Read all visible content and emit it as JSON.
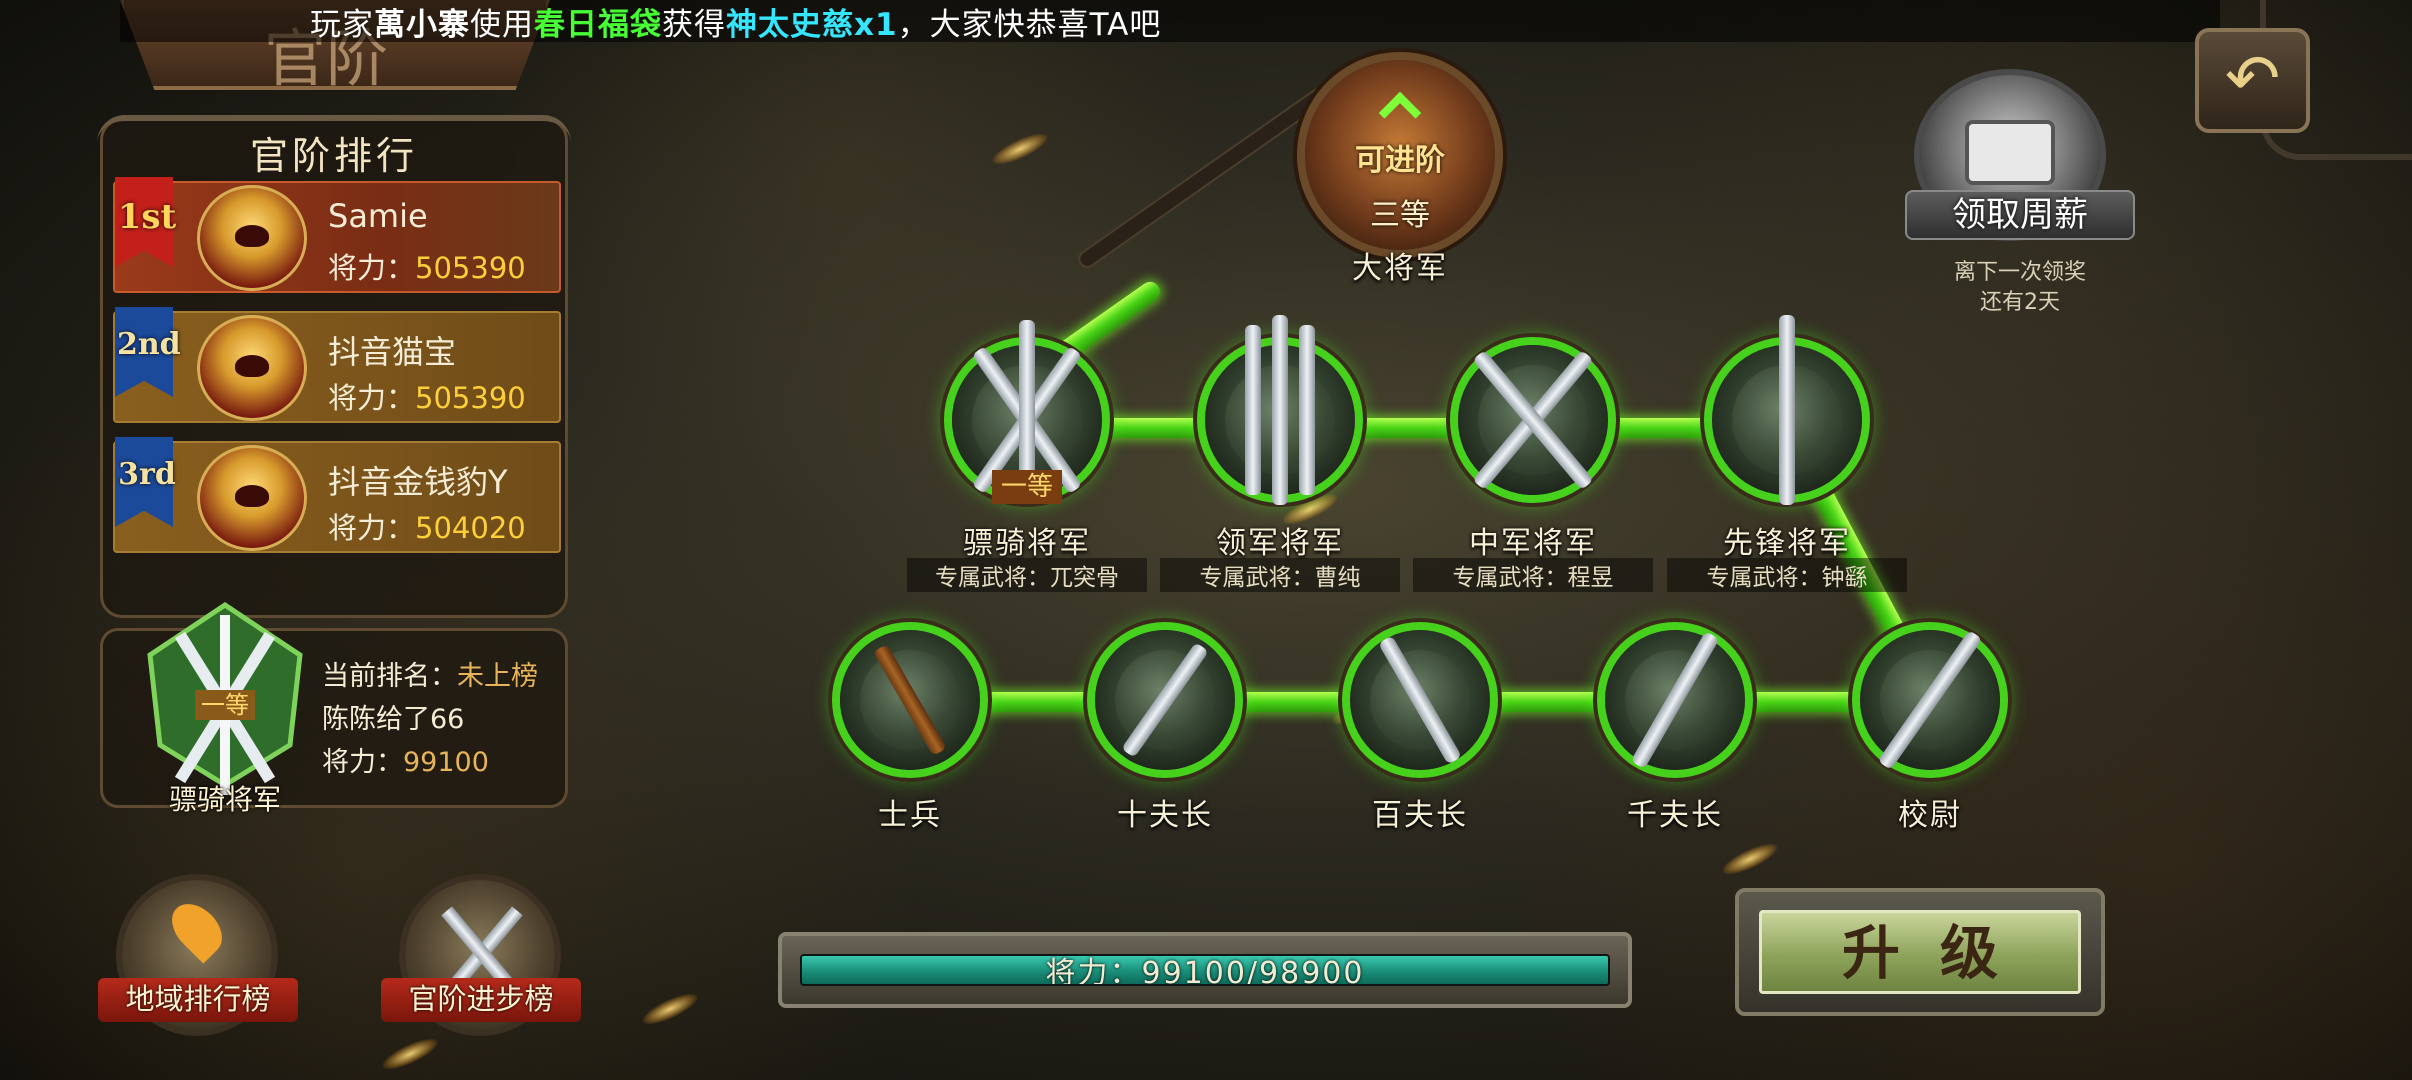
{
  "ticker": {
    "prefix": "玩家",
    "player": "萬小寨",
    "used": "使用",
    "item": "春日福袋",
    "got": "获得",
    "reward": "神太史慈x1",
    "suffix": "，大家快恭喜TA吧"
  },
  "title": "官阶",
  "ranking": {
    "title": "官阶排行",
    "power_label": "将力：",
    "rows": [
      {
        "medal": "1st",
        "name": "Samie",
        "power": "505390"
      },
      {
        "medal": "2nd",
        "name": "抖音猫宝",
        "power": "505390"
      },
      {
        "medal": "3rd",
        "name": "抖音金钱豹Y",
        "power": "504020"
      }
    ]
  },
  "my_rank": {
    "emblem_grade": "一等",
    "emblem_name": "骠骑将军",
    "current_rank_label": "当前排名：",
    "current_rank_value": "未上榜",
    "player_name": "陈陈给了66",
    "power_label": "将力：",
    "power_value": "99100"
  },
  "ranks": {
    "top": {
      "status": "可进阶",
      "grade": "三等",
      "name": "大将军"
    },
    "generals": [
      {
        "name": "骠骑将军",
        "grade": "一等",
        "bound": "专属武将：兀突骨"
      },
      {
        "name": "领军将军",
        "bound": "专属武将：曹纯"
      },
      {
        "name": "中军将军",
        "bound": "专属武将：程昱"
      },
      {
        "name": "先锋将军",
        "bound": "专属武将：钟繇"
      }
    ],
    "soldiers": [
      {
        "name": "士兵"
      },
      {
        "name": "十夫长"
      },
      {
        "name": "百夫长"
      },
      {
        "name": "千夫长"
      },
      {
        "name": "校尉"
      }
    ]
  },
  "weekly_salary": {
    "label": "领取周薪",
    "note_line1": "离下一次领奖",
    "note_line2": "还有2天"
  },
  "bottom": {
    "region_rank": "地域排行榜",
    "progress_rank": "官阶进步榜"
  },
  "progress": {
    "text": "将力：99100/98900",
    "fraction": 1.0
  },
  "upgrade_label": "升级"
}
